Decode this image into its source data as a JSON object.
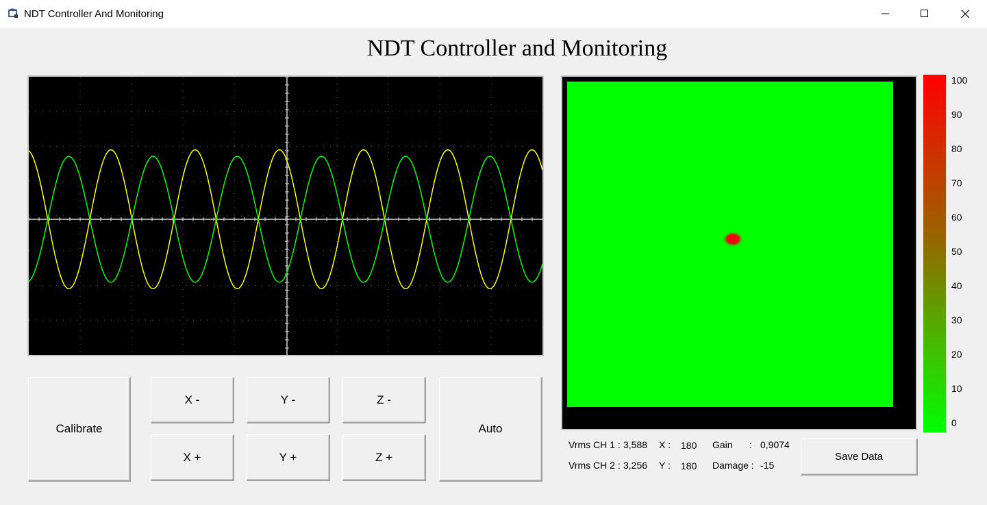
{
  "window": {
    "title": "NDT Controller And Monitoring",
    "minimize_icon": "minimize-icon",
    "maximize_icon": "maximize-icon",
    "close_icon": "close-icon"
  },
  "heading": "NDT Controller and Monitoring",
  "oscilloscope": {
    "background": "#000000",
    "traces": [
      {
        "color": "#ffff00",
        "amplitude_rel": 0.64,
        "cycles": 6
      },
      {
        "color": "#00ff00",
        "amplitude_rel": 0.58,
        "cycles": 6
      }
    ]
  },
  "buttons": {
    "calibrate": "Calibrate",
    "x_minus": "X -",
    "y_minus": "Y -",
    "z_minus": "Z -",
    "x_plus": "X +",
    "y_plus": "Y +",
    "z_plus": "Z +",
    "auto": "Auto",
    "save": "Save Data"
  },
  "heatmap": {
    "fill_color": "#00ff00",
    "hotspot_color": "#ff0000"
  },
  "color_scale": {
    "labels": [
      "100",
      "90",
      "80",
      "70",
      "60",
      "50",
      "40",
      "30",
      "20",
      "10",
      "0"
    ],
    "top_color": "#ff0000",
    "bottom_color": "#00ff00"
  },
  "readouts": {
    "vrms_ch1_label": "Vrms CH 1 :",
    "vrms_ch1_value": "3,588",
    "vrms_ch2_label": "Vrms CH 2 :",
    "vrms_ch2_value": "3,256",
    "x_label": "X :",
    "x_value": "180",
    "y_label": "Y :",
    "y_value": "180",
    "gain_label": "Gain",
    "gain_colon": ":",
    "gain_value": "0,9074",
    "damage_label": "Damage :",
    "damage_value": "-15"
  }
}
